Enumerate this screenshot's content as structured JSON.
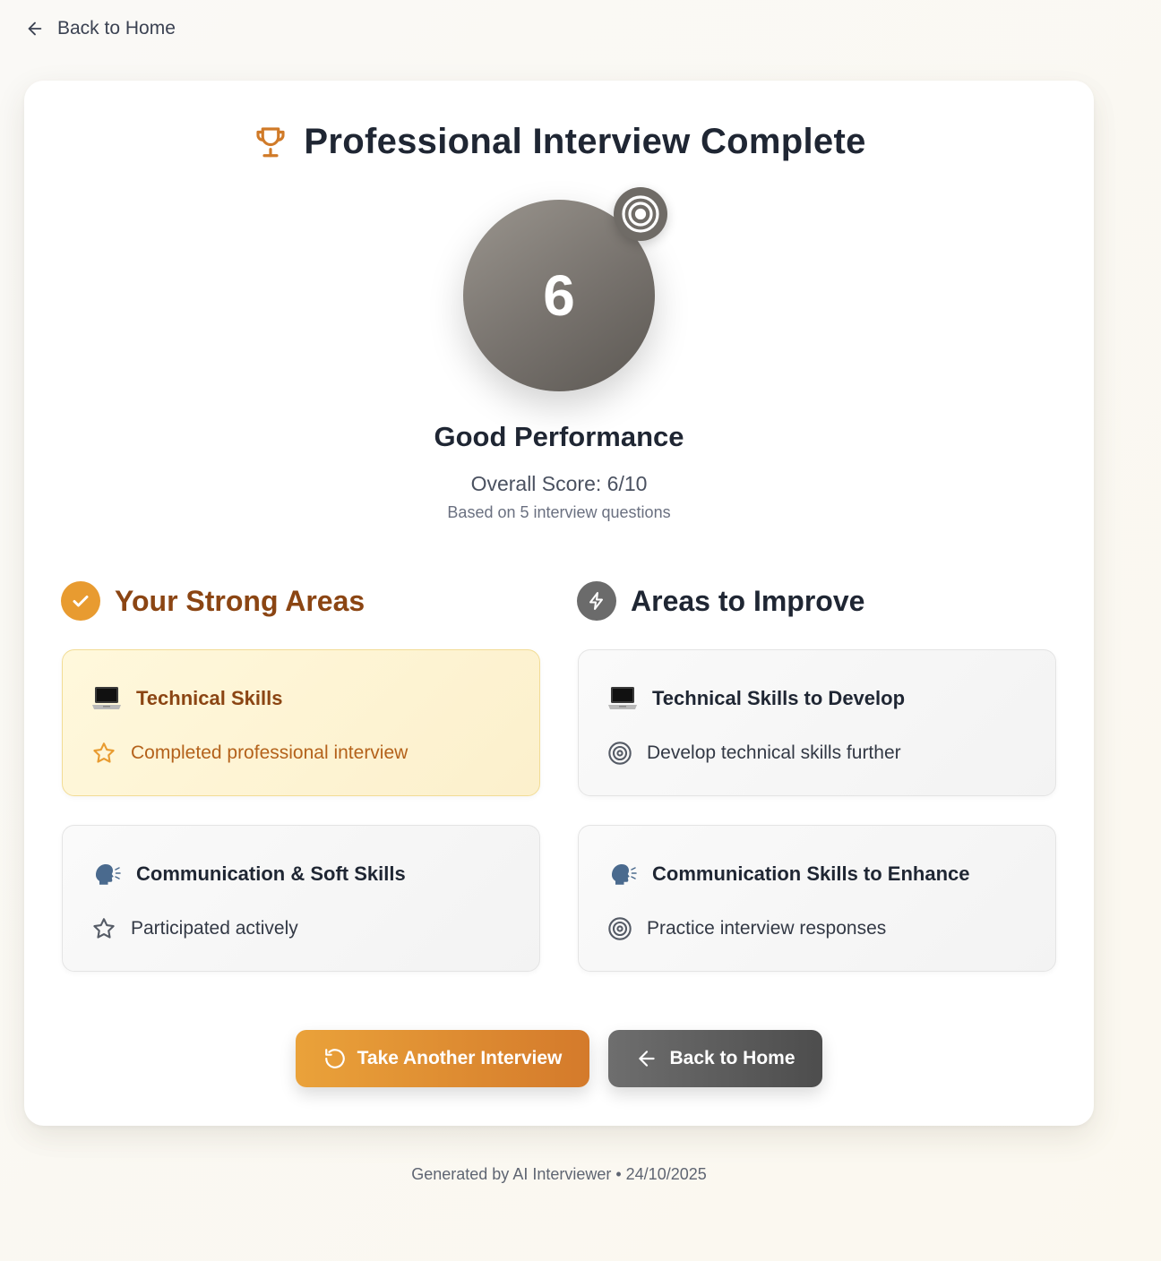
{
  "nav": {
    "back_label": "Back to Home"
  },
  "header": {
    "title": "Professional Interview Complete"
  },
  "score": {
    "value": "6",
    "performance": "Good Performance",
    "overall": "Overall Score: 6/10",
    "based_on": "Based on 5 interview questions"
  },
  "strong": {
    "heading": "Your Strong Areas",
    "cards": [
      {
        "title": "Technical Skills",
        "item": "Completed professional interview",
        "icon": "laptop-emoji"
      },
      {
        "title": "Communication & Soft Skills",
        "item": "Participated actively",
        "icon": "speaking-head-emoji"
      }
    ]
  },
  "improve": {
    "heading": "Areas to Improve",
    "cards": [
      {
        "title": "Technical Skills to Develop",
        "item": "Develop technical skills further",
        "icon": "laptop-emoji"
      },
      {
        "title": "Communication Skills to Enhance",
        "item": "Practice interview responses",
        "icon": "speaking-head-emoji"
      }
    ]
  },
  "actions": {
    "another_label": "Take Another Interview",
    "home_label": "Back to Home"
  },
  "footer": {
    "text": "Generated by AI Interviewer • 24/10/2025"
  },
  "colors": {
    "accent": "#e89b30",
    "strong_heading": "#8b4513",
    "neutral": "#6b6b6b"
  }
}
